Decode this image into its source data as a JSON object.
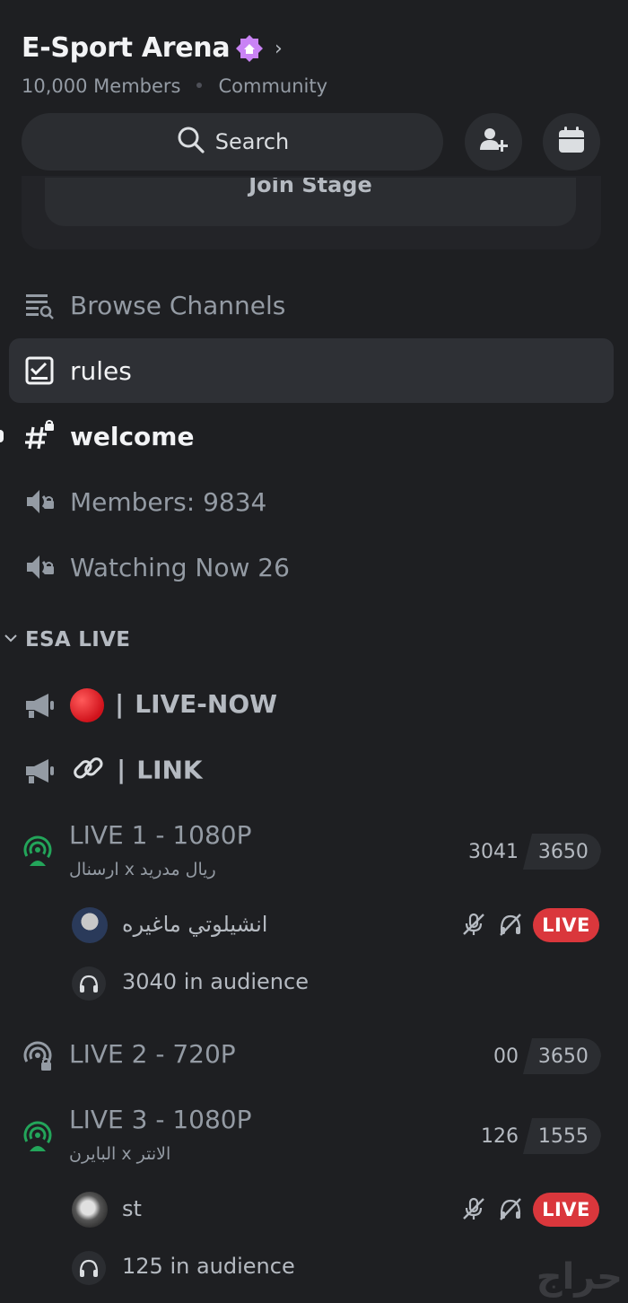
{
  "server": {
    "name": "E-Sport Arena",
    "members": "10,000 Members",
    "type": "Community"
  },
  "search": {
    "label": "Search"
  },
  "stage_card": {
    "button": "Join Stage"
  },
  "channels": [
    {
      "name": "Browse Channels",
      "icon": "browse-channels-icon"
    },
    {
      "name": "rules",
      "icon": "rules-icon"
    },
    {
      "name": "welcome",
      "icon": "hashtag-lock-icon"
    },
    {
      "name": "Members: 9834",
      "icon": "voice-locked-icon"
    },
    {
      "name": "Watching Now 26",
      "icon": "voice-locked-icon"
    }
  ],
  "category": {
    "name": "ESA LIVE"
  },
  "announcements": [
    {
      "emoji": "🔴",
      "separator": "|",
      "name": "LIVE-NOW"
    },
    {
      "emoji": "🔗",
      "separator": "|",
      "name": "LINK"
    }
  ],
  "stages": [
    {
      "title": "LIVE 1 - 1080P",
      "topic": "ريال مدريد x ارسنال",
      "count": "3041",
      "capacity": "3650",
      "speaker": "انشيلوتي ماغيره",
      "live_label": "LIVE",
      "audience": "3040 in audience"
    },
    {
      "title": "LIVE 2 - 720P",
      "count": "00",
      "capacity": "3650"
    },
    {
      "title": "LIVE 3 - 1080P",
      "topic": "الانتر x البايرن",
      "count": "126",
      "capacity": "1555",
      "speaker": "st",
      "live_label": "LIVE",
      "audience": "125 in audience"
    }
  ],
  "watermark": "حراج",
  "colors": {
    "background": "#1e1f22",
    "live_green": "#23a55a",
    "live_red": "#da373c",
    "boost_purple": "#c983f5"
  }
}
